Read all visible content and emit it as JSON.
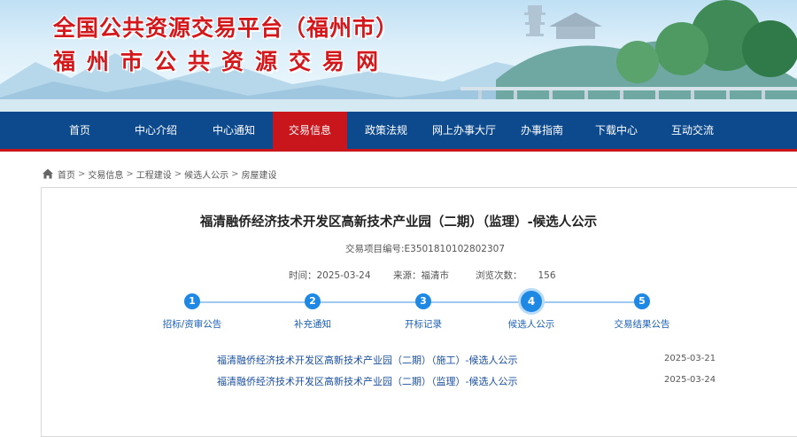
{
  "header": {
    "title_line1": "全国公共资源交易平台（福州市）",
    "title_line2": "福州市公共资源交易网"
  },
  "nav": {
    "items": [
      {
        "label": "首页"
      },
      {
        "label": "中心介绍"
      },
      {
        "label": "中心通知"
      },
      {
        "label": "交易信息",
        "active": true
      },
      {
        "label": "政策法规"
      },
      {
        "label": "网上办事大厅"
      },
      {
        "label": "办事指南"
      },
      {
        "label": "下载中心"
      },
      {
        "label": "互动交流"
      }
    ],
    "colors": {
      "background": "#0d4a8d",
      "active": "#c9161d"
    }
  },
  "breadcrumb": {
    "icon": "home-icon",
    "items": [
      "首页",
      "交易信息",
      "工程建设",
      "候选人公示",
      "房屋建设"
    ],
    "separator": ">"
  },
  "article": {
    "title": "福清融侨经济技术开发区高新技术产业园（二期）（监理）-候选人公示",
    "trade_no": "交易项目编号:E3501810102802307",
    "time_label": "时间：",
    "time_value": "2025-03-24",
    "source_label": "来源：",
    "source_value": "福清市",
    "views_label": "浏览次数：",
    "views_value": "156"
  },
  "steps": {
    "items": [
      {
        "num": "1",
        "label": "招标/资审公告"
      },
      {
        "num": "2",
        "label": "补充通知"
      },
      {
        "num": "3",
        "label": "开标记录"
      },
      {
        "num": "4",
        "label": "候选人公示",
        "active": true
      },
      {
        "num": "5",
        "label": "交易结果公告"
      }
    ],
    "color": "#1e88e5"
  },
  "projects": [
    {
      "title": "福清融侨经济技术开发区高新技术产业园（二期）（施工）-候选人公示",
      "date": "2025-03-21"
    },
    {
      "title": "福清融侨经济技术开发区高新技术产业园（二期）（监理）-候选人公示",
      "date": "2025-03-24"
    }
  ]
}
